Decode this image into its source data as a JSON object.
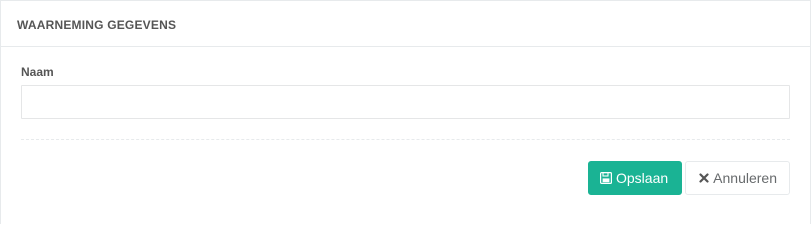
{
  "panel": {
    "title": "WAARNEMING GEGEVENS"
  },
  "form": {
    "name_label": "Naam",
    "name_value": "",
    "name_placeholder": ""
  },
  "actions": {
    "save_label": "Opslaan",
    "save_icon": "floppy-disk-icon",
    "cancel_label": "Annuleren",
    "cancel_icon": "close-icon"
  },
  "colors": {
    "primary": "#1ab394",
    "border": "#e7eaec",
    "text": "#555555"
  }
}
